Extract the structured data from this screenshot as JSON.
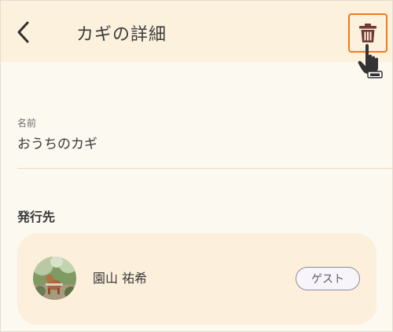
{
  "header": {
    "title": "カギの詳細",
    "back_icon": "chevron-left-icon",
    "delete_icon": "trash-icon"
  },
  "key": {
    "name_label": "名前",
    "name_value": "おうちのカギ"
  },
  "issued_to": {
    "section_title": "発行先",
    "user_name": "園山 祐希",
    "badge": "ゲスト"
  },
  "colors": {
    "header_bg": "#fcf1dd",
    "page_bg": "#fcf9f1",
    "card_bg": "#fcefdc",
    "highlight": "#f07a1c",
    "trash": "#6e3a31"
  }
}
